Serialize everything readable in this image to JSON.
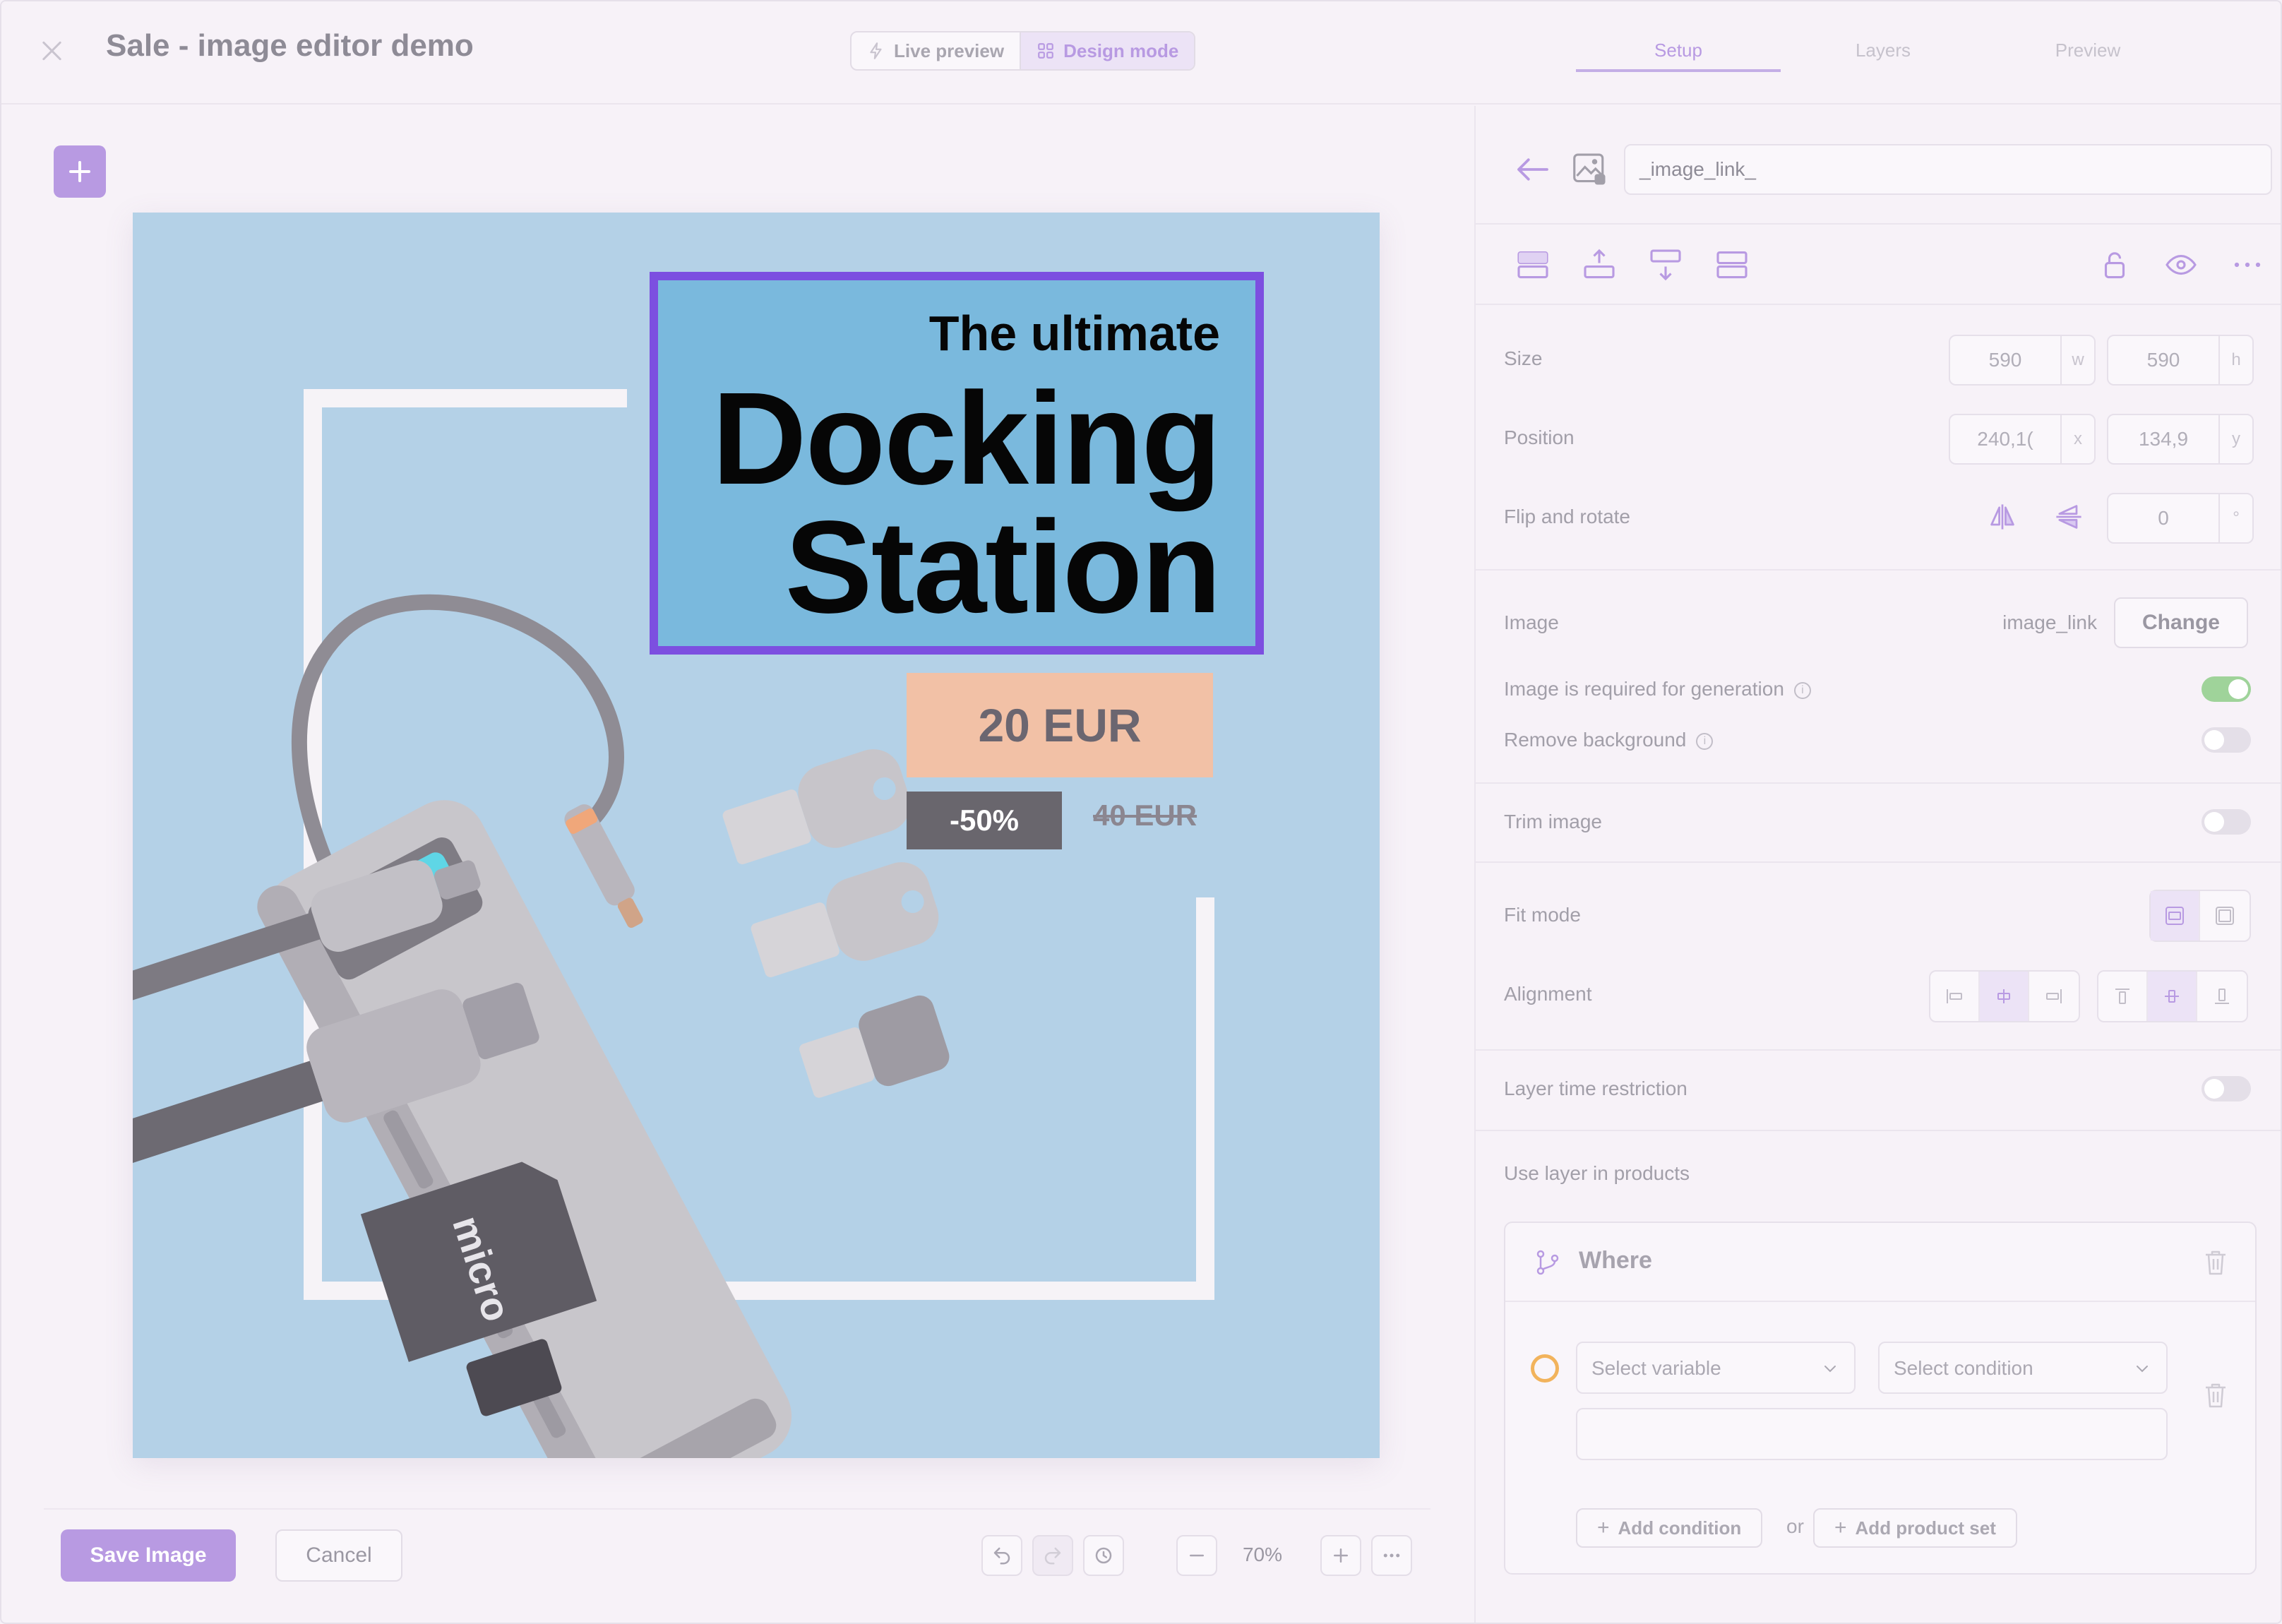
{
  "header": {
    "title": "Sale - image editor demo",
    "mode_live": "Live preview",
    "mode_design": "Design mode",
    "tabs": [
      {
        "label": "Setup"
      },
      {
        "label": "Layers"
      },
      {
        "label": "Preview"
      }
    ]
  },
  "canvas": {
    "headline_small": "The ultimate",
    "headline_line1": "Docking",
    "headline_line2": "Station",
    "price": "20 EUR",
    "discount": "-50%",
    "old_price": "40 EUR"
  },
  "bottom_bar": {
    "save_label": "Save Image",
    "cancel_label": "Cancel",
    "zoom": "70%"
  },
  "panel": {
    "link_value": "_image_link_",
    "size_label": "Size",
    "size_w": "590",
    "size_h": "590",
    "unit_w": "w",
    "unit_h": "h",
    "position_label": "Position",
    "position_x": "240,1(",
    "position_y": "134,9",
    "unit_x": "x",
    "unit_y": "y",
    "flip_label": "Flip and rotate",
    "rotate_value": "0",
    "unit_deg": "°",
    "image_label": "Image",
    "image_value": "image_link",
    "change_label": "Change",
    "required_label": "Image is required for generation",
    "required_on": true,
    "remove_bg_label": "Remove background",
    "remove_bg_on": false,
    "trim_label": "Trim image",
    "trim_on": false,
    "fit_label": "Fit mode",
    "alignment_label": "Alignment",
    "time_restriction_label": "Layer time restriction",
    "time_restriction_on": false,
    "use_in_products_label": "Use layer in products",
    "where_title": "Where",
    "select_variable": "Select variable",
    "select_condition": "Select condition",
    "add_condition": "Add condition",
    "or_text": "or",
    "add_product_set": "Add product set"
  },
  "colors": {
    "accent": "#b89ae2",
    "selection": "#7c4fe0",
    "artboard_bg": "#b4d1e7",
    "headline_bg": "#7ab9dd",
    "price_bg": "#f2c1a6",
    "discount_bg": "#69666d",
    "toggle_on": "#9fd39a"
  }
}
